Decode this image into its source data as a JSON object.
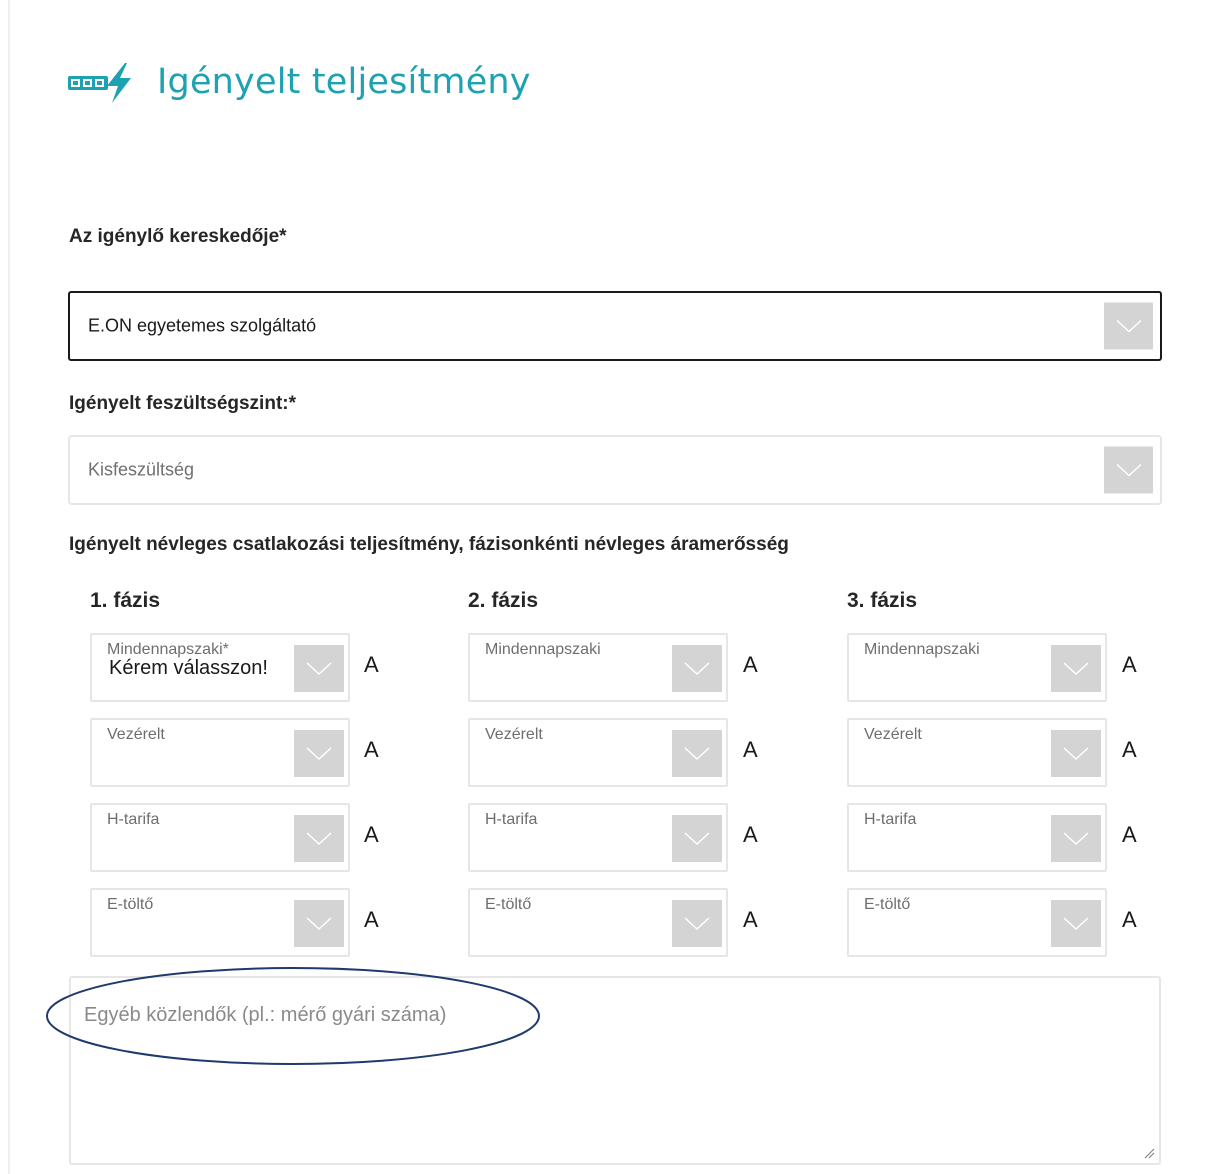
{
  "page": {
    "title": "Igényelt teljesítmény",
    "title_icon": "meter-lightning-icon",
    "accent_color": "#1ea2b1"
  },
  "supplier": {
    "label": "Az igénylő kereskedője*",
    "value": "E.ON egyetemes szolgáltató"
  },
  "voltage": {
    "label": "Igényelt feszültségszint:*",
    "value": "Kisfeszültség"
  },
  "capacity": {
    "label": "Igényelt névleges csatlakozási teljesítmény, fázisonkénti névleges áramerősség",
    "unit": "A",
    "phases": [
      {
        "title": "1. fázis",
        "fields": [
          {
            "label": "Mindennapszaki*",
            "value": "Kérem válasszon!"
          },
          {
            "label": "Vezérelt",
            "value": ""
          },
          {
            "label": "H-tarifa",
            "value": ""
          },
          {
            "label": "E-töltő",
            "value": ""
          }
        ]
      },
      {
        "title": "2. fázis",
        "fields": [
          {
            "label": "Mindennapszaki",
            "value": ""
          },
          {
            "label": "Vezérelt",
            "value": ""
          },
          {
            "label": "H-tarifa",
            "value": ""
          },
          {
            "label": "E-töltő",
            "value": ""
          }
        ]
      },
      {
        "title": "3. fázis",
        "fields": [
          {
            "label": "Mindennapszaki",
            "value": ""
          },
          {
            "label": "Vezérelt",
            "value": ""
          },
          {
            "label": "H-tarifa",
            "value": ""
          },
          {
            "label": "E-töltő",
            "value": ""
          }
        ]
      }
    ]
  },
  "comments": {
    "placeholder": "Egyéb közlendők (pl.: mérő gyári száma)",
    "value": ""
  },
  "annotation": {
    "shape": "ellipse-outline",
    "color": "#1f3a6e"
  }
}
